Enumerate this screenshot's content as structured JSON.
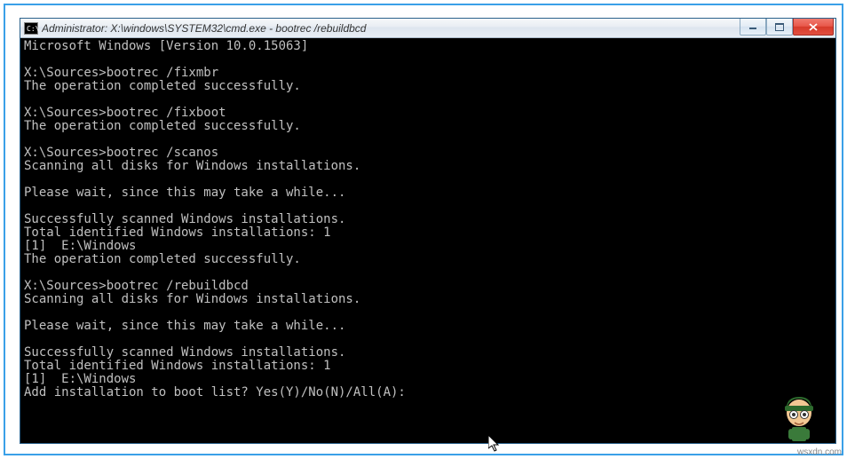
{
  "window": {
    "title": "Administrator: X:\\windows\\SYSTEM32\\cmd.exe - bootrec /rebuildbcd",
    "icon_glyph": "C:\\."
  },
  "terminal": {
    "lines": [
      "Microsoft Windows [Version 10.0.15063]",
      "",
      "X:\\Sources>bootrec /fixmbr",
      "The operation completed successfully.",
      "",
      "X:\\Sources>bootrec /fixboot",
      "The operation completed successfully.",
      "",
      "X:\\Sources>bootrec /scanos",
      "Scanning all disks for Windows installations.",
      "",
      "Please wait, since this may take a while...",
      "",
      "Successfully scanned Windows installations.",
      "Total identified Windows installations: 1",
      "[1]  E:\\Windows",
      "The operation completed successfully.",
      "",
      "X:\\Sources>bootrec /rebuildbcd",
      "Scanning all disks for Windows installations.",
      "",
      "Please wait, since this may take a while...",
      "",
      "Successfully scanned Windows installations.",
      "Total identified Windows installations: 1",
      "[1]  E:\\Windows",
      "Add installation to boot list? Yes(Y)/No(N)/All(A):"
    ]
  },
  "watermark": "wsxdn.com"
}
